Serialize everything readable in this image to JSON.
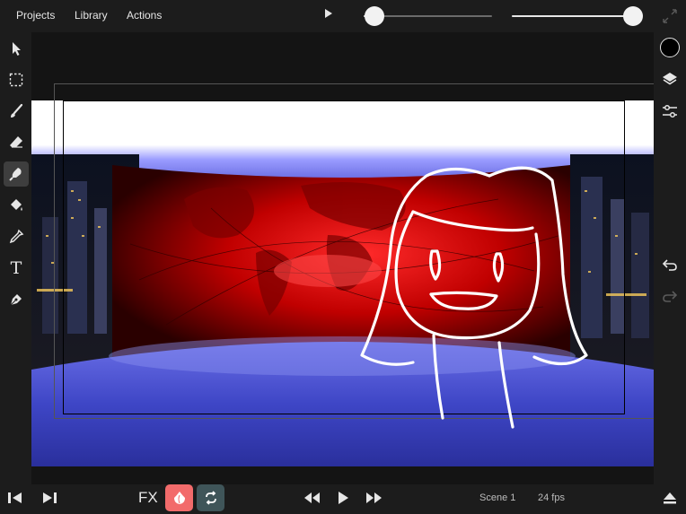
{
  "menu": {
    "projects": "Projects",
    "library": "Library",
    "actions": "Actions"
  },
  "sliders": {
    "first_value": 0.0,
    "second_value": 1.0
  },
  "left_tools": [
    {
      "icon": "selection-arrow-icon"
    },
    {
      "icon": "marquee-select-icon"
    },
    {
      "icon": "brush-icon"
    },
    {
      "icon": "eraser-icon"
    },
    {
      "icon": "smudge-icon",
      "active": true
    },
    {
      "icon": "paint-bucket-icon"
    },
    {
      "icon": "eyedropper-icon"
    },
    {
      "icon": "text-tool-icon"
    },
    {
      "icon": "pen-tool-icon"
    }
  ],
  "text_tool_glyph": "T",
  "right_tools": [
    "color-swatch-icon",
    "layers-icon",
    "adjustments-icon",
    "undo-icon",
    "redo-icon"
  ],
  "current_color": "#000000",
  "bottom": {
    "fx_label": "FX",
    "onion_color": "#f26b6b",
    "loop_color": "#3f5559",
    "scene_label": "Scene 1",
    "fps_label": "24 fps"
  }
}
